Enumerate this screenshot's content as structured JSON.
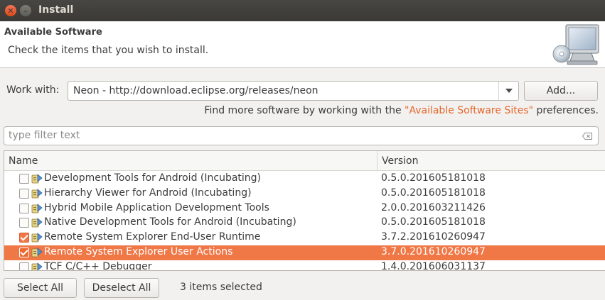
{
  "window": {
    "title": "Install"
  },
  "header": {
    "title": "Available Software",
    "description": "Check the items that you wish to install."
  },
  "work_with": {
    "label": "Work with:",
    "value": "Neon - http://download.eclipse.org/releases/neon",
    "add_label": "Add..."
  },
  "find_more": {
    "prefix": "Find more software by working with the ",
    "link": "\"Available Software Sites\"",
    "suffix": " preferences."
  },
  "filter": {
    "placeholder": "type filter text"
  },
  "table": {
    "columns": {
      "name": "Name",
      "version": "Version"
    },
    "rows": [
      {
        "name": "Development Tools for Android (Incubating)",
        "version": "0.5.0.201605181018",
        "checked": false,
        "selected": false
      },
      {
        "name": "Hierarchy Viewer for Android (Incubating)",
        "version": "0.5.0.201605181018",
        "checked": false,
        "selected": false
      },
      {
        "name": "Hybrid Mobile Application Development Tools",
        "version": "2.0.0.201603211426",
        "checked": false,
        "selected": false
      },
      {
        "name": "Native Development Tools for Android (Incubating)",
        "version": "0.5.0.201605181018",
        "checked": false,
        "selected": false
      },
      {
        "name": "Remote System Explorer End-User Runtime",
        "version": "3.7.2.201610260947",
        "checked": true,
        "selected": false
      },
      {
        "name": "Remote System Explorer User Actions",
        "version": "3.7.0.201610260947",
        "checked": true,
        "selected": true
      },
      {
        "name": "TCF C/C++ Debugger",
        "version": "1.4.0.201606031137",
        "checked": false,
        "selected": false
      }
    ]
  },
  "footer": {
    "select_all_label": "Select All",
    "deselect_all_label": "Deselect All",
    "status": "3 items selected"
  },
  "colors": {
    "accent": "#f07746",
    "link": "#e5672a",
    "titlebar": "#3b3a36"
  },
  "icons": {
    "close": "close-icon",
    "minimize": "minimize-icon",
    "header": "computer-cd-icon",
    "dropdown": "chevron-down-icon",
    "clear": "clear-filter-icon",
    "row": "plugin-feature-icon"
  }
}
